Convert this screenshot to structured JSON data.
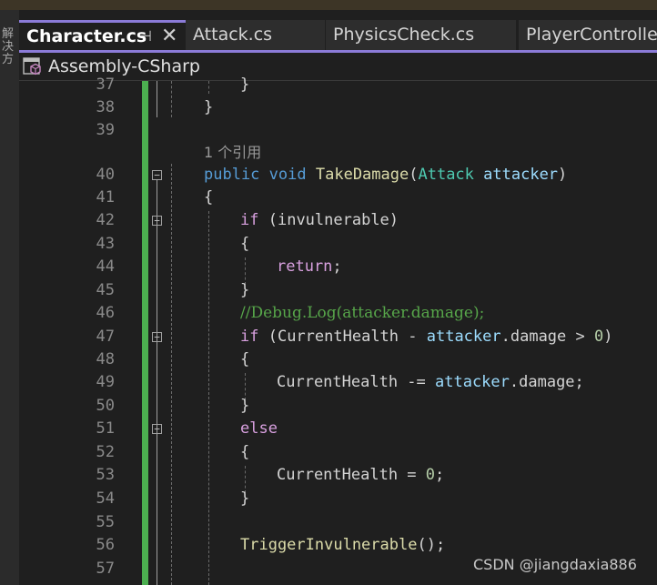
{
  "sidebar": {
    "vertical_text": "解决方"
  },
  "tabs": [
    {
      "label": "Character.cs",
      "active": true
    },
    {
      "label": "Attack.cs",
      "active": false
    },
    {
      "label": "PhysicsCheck.cs",
      "active": false
    },
    {
      "label": "PlayerController.",
      "active": false
    }
  ],
  "tab_icons": {
    "pin": "pin-icon",
    "close": "close-icon"
  },
  "navbar": {
    "project": "Assembly-CSharp",
    "icon": "cube-icon"
  },
  "colors": {
    "accent": "#8b7bd8",
    "change_bar": "#4caf50",
    "keyword": "#569cd6",
    "control": "#d8a0df",
    "method": "#dcdcaa",
    "type": "#4ec9b0",
    "variable": "#9cdcfe",
    "comment": "#57a64a"
  },
  "code": {
    "ref_hint": "1 个引用",
    "lines": [
      {
        "n": "37",
        "text": "}"
      },
      {
        "n": "38",
        "text": "}"
      },
      {
        "n": "39",
        "text": ""
      },
      {
        "n": "40",
        "t": [
          "public",
          "void",
          "TakeDamage",
          "(",
          "Attack",
          "attacker",
          ")"
        ]
      },
      {
        "n": "41",
        "text": "{"
      },
      {
        "n": "42",
        "t": [
          "if",
          "(invulnerable)"
        ]
      },
      {
        "n": "43",
        "text": "{"
      },
      {
        "n": "44",
        "t": [
          "return",
          ";"
        ]
      },
      {
        "n": "45",
        "text": "}"
      },
      {
        "n": "46",
        "text": "//Debug.Log(attacker.damage);"
      },
      {
        "n": "47",
        "t": [
          "if",
          "(CurrentHealth - ",
          "attacker",
          ".damage > ",
          "0",
          ")"
        ]
      },
      {
        "n": "48",
        "text": "{"
      },
      {
        "n": "49",
        "t": [
          "CurrentHealth -= ",
          "attacker",
          ".damage;"
        ]
      },
      {
        "n": "50",
        "text": "}"
      },
      {
        "n": "51",
        "text": "else"
      },
      {
        "n": "52",
        "text": "{"
      },
      {
        "n": "53",
        "t": [
          "CurrentHealth = ",
          "0",
          ";"
        ]
      },
      {
        "n": "54",
        "text": "}"
      },
      {
        "n": "55",
        "text": ""
      },
      {
        "n": "56",
        "t": [
          "TriggerInvulnerable",
          "();"
        ]
      },
      {
        "n": "57",
        "text": ""
      }
    ]
  },
  "watermark": "CSDN @jiangdaxia886"
}
